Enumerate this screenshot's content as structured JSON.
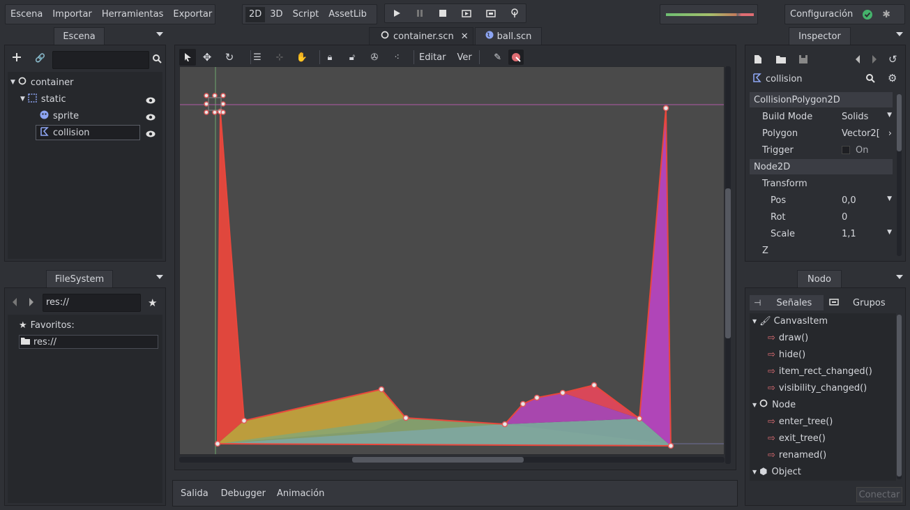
{
  "menu": {
    "scene": "Escena",
    "import": "Importar",
    "tools": "Herramientas",
    "export": "Exportar"
  },
  "modes": {
    "m2d": "2D",
    "m3d": "3D",
    "script": "Script",
    "assetlib": "AssetLib"
  },
  "settings": {
    "label": "Configuración"
  },
  "scene_dock": {
    "title": "Escena",
    "search_placeholder": "",
    "tree": [
      {
        "label": "container"
      },
      {
        "label": "static"
      },
      {
        "label": "sprite"
      },
      {
        "label": "collision"
      }
    ]
  },
  "fs_dock": {
    "title": "FileSystem",
    "path": "res://",
    "favorites": "Favoritos:",
    "item": "res://"
  },
  "editor_tabs": [
    {
      "label": "container.scn"
    },
    {
      "label": "ball.scn"
    }
  ],
  "toolbar": {
    "edit": "Editar",
    "view": "Ver"
  },
  "bottom": {
    "output": "Salida",
    "debugger": "Debugger",
    "animation": "Animación"
  },
  "inspector": {
    "title": "Inspector",
    "node_name": "collision",
    "section1": "CollisionPolygon2D",
    "props1": [
      {
        "name": "Build Mode",
        "value": "Solids"
      },
      {
        "name": "Polygon",
        "value": "Vector2["
      },
      {
        "name": "Trigger",
        "value": "On"
      }
    ],
    "section2": "Node2D",
    "transform": "Transform",
    "props2": [
      {
        "name": "Pos",
        "value": "0,0"
      },
      {
        "name": "Rot",
        "value": "0"
      },
      {
        "name": "Scale",
        "value": "1,1"
      }
    ],
    "z": "Z"
  },
  "node_dock": {
    "title": "Nodo",
    "signals_tab": "Señales",
    "groups_tab": "Grupos",
    "canvas_item": "CanvasItem",
    "ci_signals": [
      "draw()",
      "hide()",
      "item_rect_changed()",
      "visibility_changed()"
    ],
    "node": "Node",
    "node_signals": [
      "enter_tree()",
      "exit_tree()",
      "renamed()"
    ],
    "object": "Object",
    "connect": "Conectar"
  },
  "colors": {
    "accent": "#e74c3c",
    "magenta": "#a946b5",
    "yellow": "#c7a63e",
    "teal": "#7fa89a"
  }
}
